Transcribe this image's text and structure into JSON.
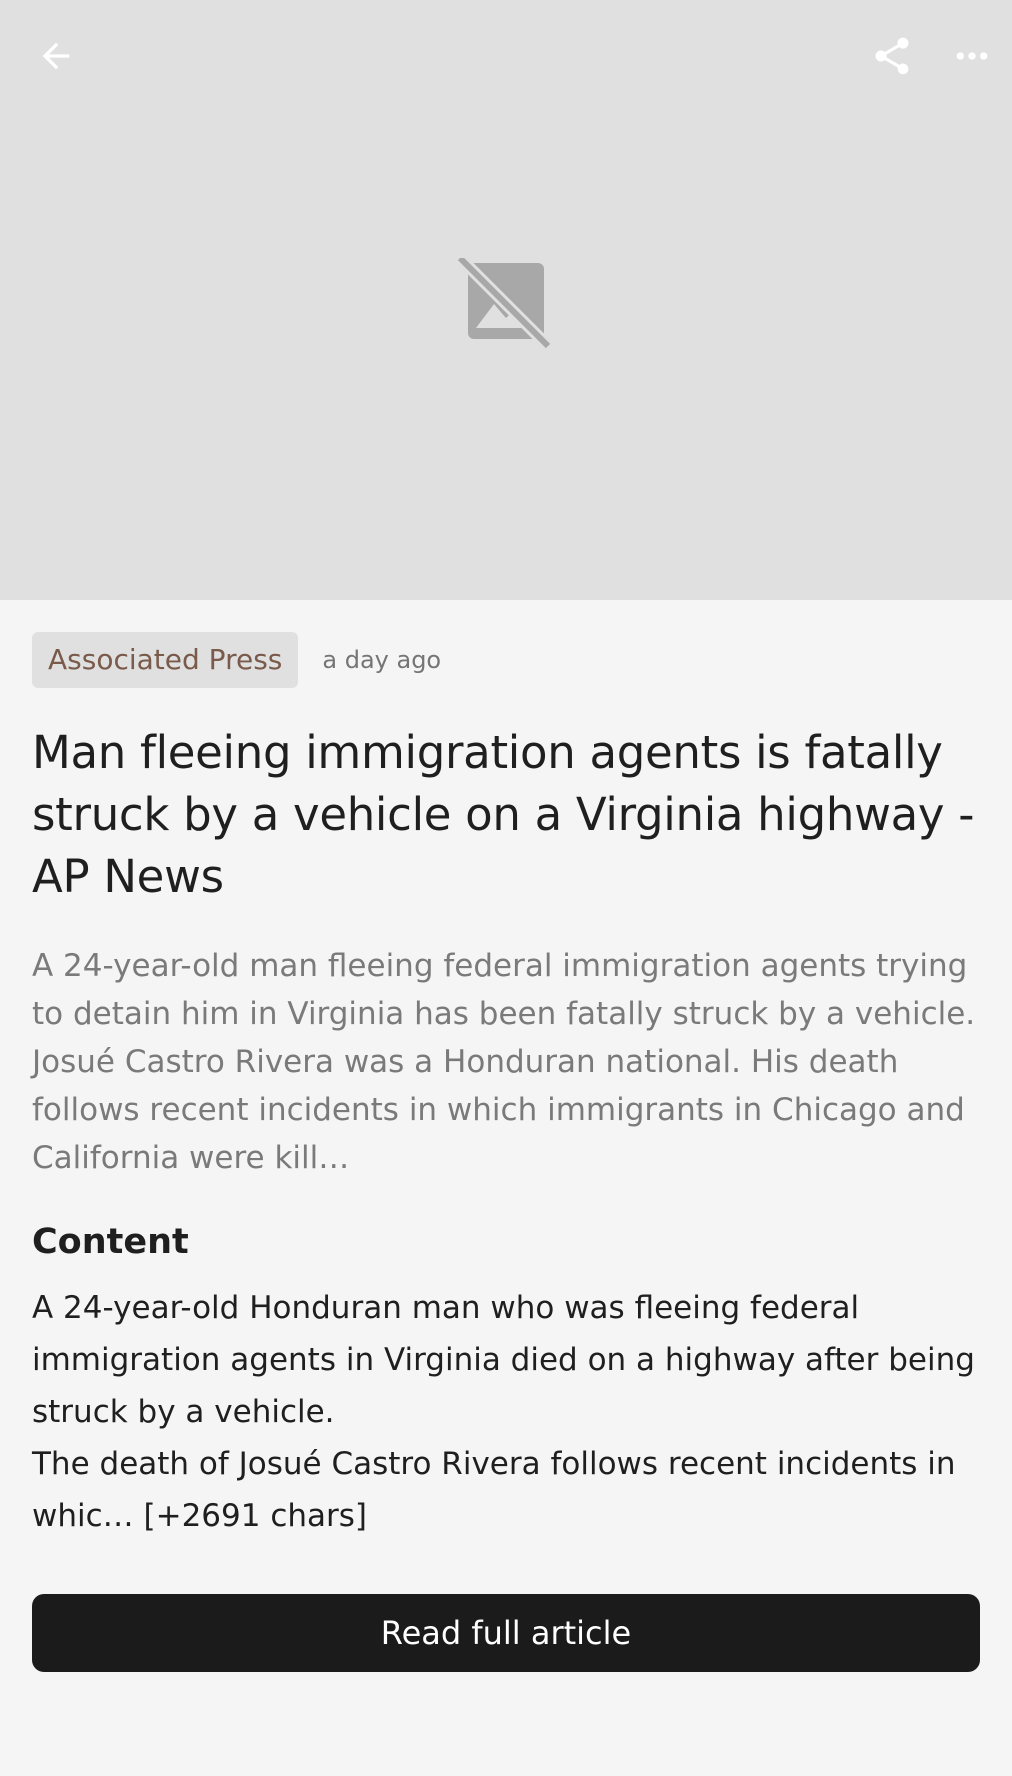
{
  "topbar": {
    "back_icon": "arrow-back-icon",
    "share_icon": "share-icon",
    "more_icon": "more-horizontal-icon"
  },
  "hero": {
    "placeholder_icon": "image-not-supported-icon"
  },
  "article": {
    "source": "Associated Press",
    "time_ago": "a day ago",
    "title": "Man fleeing immigration agents is fatally struck by a vehicle on a Virginia highway - AP News",
    "summary": "A 24-year-old man fleeing federal immigration agents trying to detain him in Virginia has been fatally struck by a vehicle. Josué Castro Rivera was a Honduran national. His death follows recent incidents in which immigrants in Chicago and California were kill…",
    "content_heading": "Content",
    "content_paragraph_1": "A 24-year-old Honduran man who was fleeing federal immigration agents in Virginia died on a highway after being struck by a vehicle.",
    "content_paragraph_2": "The death of Josué Castro Rivera follows recent incidents in whic… [+2691 chars]"
  },
  "actions": {
    "read_full_label": "Read full article"
  },
  "colors": {
    "hero_bg": "#e0e0e0",
    "badge_text": "#7a5a4a",
    "button_bg": "#1b1b1b"
  }
}
